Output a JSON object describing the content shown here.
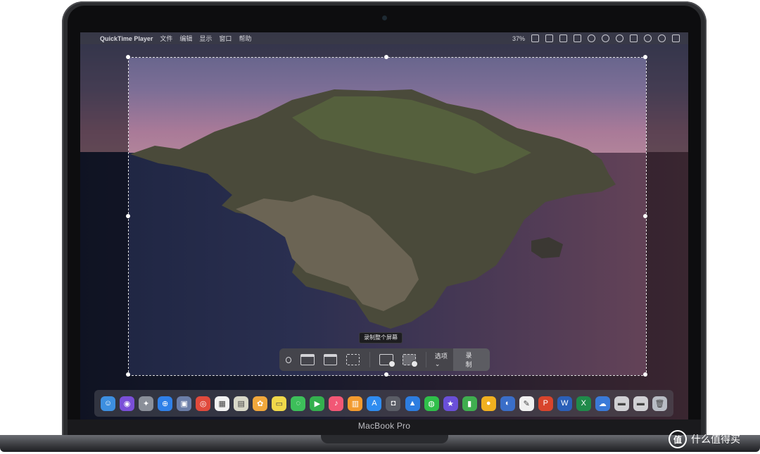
{
  "menubar": {
    "apple": "",
    "app_name": "QuickTime Player",
    "items": [
      "文件",
      "编辑",
      "显示",
      "窗口",
      "帮助"
    ],
    "status_text": "37%"
  },
  "tooltip": "录制整个屏幕",
  "toolbar": {
    "options_label": "选项",
    "options_arrow": "⌄",
    "record_label": "录制"
  },
  "dock": {
    "icons": [
      {
        "name": "finder-icon",
        "color": "#3d8fe0",
        "glyph": "☺"
      },
      {
        "name": "siri-icon",
        "color": "#7a4fd8",
        "glyph": "◉"
      },
      {
        "name": "launchpad-icon",
        "color": "#8a8f99",
        "glyph": "✦"
      },
      {
        "name": "safari-icon",
        "color": "#2f80e8",
        "glyph": "⊕"
      },
      {
        "name": "photos-viewer-icon",
        "color": "#6b7ea8",
        "glyph": "▣"
      },
      {
        "name": "chrome-icon",
        "color": "#e04a3c",
        "glyph": "◎"
      },
      {
        "name": "calendar-icon",
        "color": "#f2f2f2",
        "glyph": "▦"
      },
      {
        "name": "notes-icon",
        "color": "#d8d8c8",
        "glyph": "▤"
      },
      {
        "name": "photos-icon",
        "color": "#f1a83c",
        "glyph": "✿"
      },
      {
        "name": "stickies-icon",
        "color": "#f0d84a",
        "glyph": "▭"
      },
      {
        "name": "messages-icon",
        "color": "#3dbf5a",
        "glyph": "◌"
      },
      {
        "name": "facetime-icon",
        "color": "#34b04e",
        "glyph": "▶"
      },
      {
        "name": "music-icon",
        "color": "#f25775",
        "glyph": "♪"
      },
      {
        "name": "books-icon",
        "color": "#f29a2e",
        "glyph": "▥"
      },
      {
        "name": "app-store-icon",
        "color": "#2f8cf0",
        "glyph": "A"
      },
      {
        "name": "screenshot-icon",
        "color": "#5a5d66",
        "glyph": "◘"
      },
      {
        "name": "keynote-icon",
        "color": "#2d7de0",
        "glyph": "▲"
      },
      {
        "name": "wechat-icon",
        "color": "#2fbf4a",
        "glyph": "◍"
      },
      {
        "name": "imovie-icon",
        "color": "#6a4fd8",
        "glyph": "★"
      },
      {
        "name": "numbers-icon",
        "color": "#3fae4f",
        "glyph": "▮"
      },
      {
        "name": "sun-app-icon",
        "color": "#f0b020",
        "glyph": "●"
      },
      {
        "name": "quicktime-icon",
        "color": "#3a6ec8",
        "glyph": "◐"
      },
      {
        "name": "pages-icon",
        "color": "#f0f0f0",
        "glyph": "✎"
      },
      {
        "name": "powerpoint-icon",
        "color": "#d8442c",
        "glyph": "P"
      },
      {
        "name": "word-icon",
        "color": "#2b5fb8",
        "glyph": "W"
      },
      {
        "name": "excel-icon",
        "color": "#1f8a4a",
        "glyph": "X"
      },
      {
        "name": "cloud-app-icon",
        "color": "#3a7ad8",
        "glyph": "☁"
      },
      {
        "name": "downloads-stack-icon",
        "color": "#d0d0d4",
        "glyph": "▬"
      },
      {
        "name": "documents-stack-icon",
        "color": "#d0d0d4",
        "glyph": "▬"
      },
      {
        "name": "trash-icon",
        "color": "#b8bcc4",
        "glyph": "🗑"
      }
    ]
  },
  "laptop_label": "MacBook Pro",
  "watermark": {
    "logo": "值",
    "text": "什么值得买"
  }
}
